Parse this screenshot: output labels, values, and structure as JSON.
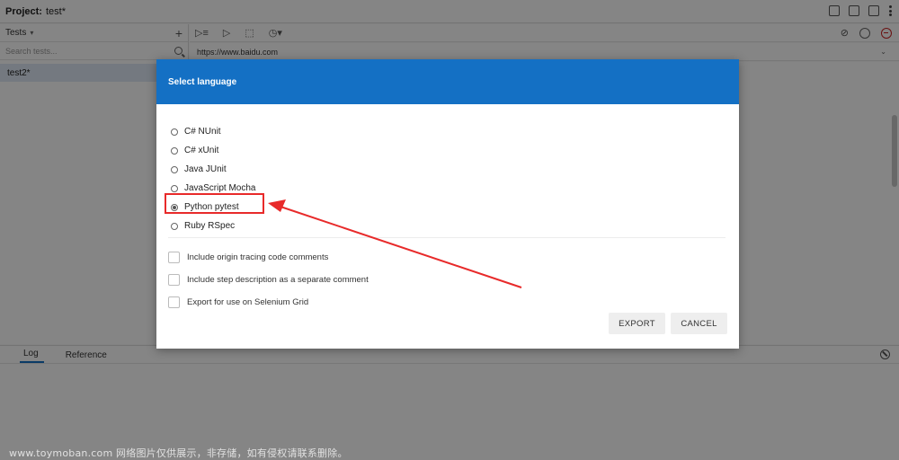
{
  "titlebar": {
    "project_label": "Project:",
    "project_name": "test*"
  },
  "sidebar": {
    "dropdown_label": "Tests",
    "add_symbol": "+",
    "search_placeholder": "Search tests...",
    "tests": [
      {
        "name": "test2*"
      }
    ]
  },
  "toolbar": {
    "url": "https://www.baidu.com"
  },
  "bottom_panel": {
    "tabs": [
      "Log",
      "Reference"
    ]
  },
  "dialog": {
    "title": "Select language",
    "languages": [
      {
        "label": "C# NUnit",
        "selected": false
      },
      {
        "label": "C# xUnit",
        "selected": false
      },
      {
        "label": "Java JUnit",
        "selected": false
      },
      {
        "label": "JavaScript Mocha",
        "selected": false
      },
      {
        "label": "Python pytest",
        "selected": true
      },
      {
        "label": "Ruby RSpec",
        "selected": false
      }
    ],
    "options": [
      {
        "label": "Include origin tracing code comments",
        "checked": false
      },
      {
        "label": "Include step description as a separate comment",
        "checked": false
      },
      {
        "label": "Export for use on Selenium Grid",
        "checked": false
      }
    ],
    "export_label": "EXPORT",
    "cancel_label": "CANCEL"
  },
  "annotation": {
    "highlight_color": "#e82a2a"
  },
  "colors": {
    "accent": "#1470c4"
  },
  "watermark": "www.toymoban.com 网络图片仅供展示，非存储，如有侵权请联系删除。"
}
